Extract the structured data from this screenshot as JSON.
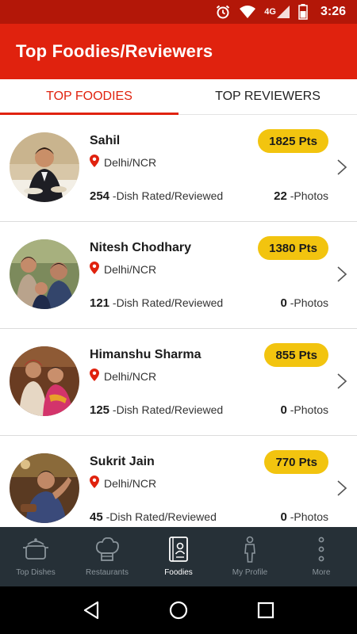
{
  "status_bar": {
    "time": "3:26",
    "network": "4G"
  },
  "app_bar": {
    "title": "Top Foodies/Reviewers"
  },
  "tabs": [
    {
      "label": "TOP FOODIES",
      "active": true
    },
    {
      "label": "TOP REVIEWERS",
      "active": false
    }
  ],
  "users": [
    {
      "name": "Sahil",
      "points": "1825 Pts",
      "location": "Delhi/NCR",
      "dishes": "254",
      "dishes_label": "-Dish Rated/Reviewed",
      "photos": "22",
      "photos_label": "-Photos"
    },
    {
      "name": "Nitesh Chodhary",
      "points": "1380 Pts",
      "location": "Delhi/NCR",
      "dishes": "121",
      "dishes_label": "-Dish Rated/Reviewed",
      "photos": "0",
      "photos_label": "-Photos"
    },
    {
      "name": "Himanshu Sharma",
      "points": "855 Pts",
      "location": "Delhi/NCR",
      "dishes": "125",
      "dishes_label": "-Dish Rated/Reviewed",
      "photos": "0",
      "photos_label": "-Photos"
    },
    {
      "name": "Sukrit Jain",
      "points": "770 Pts",
      "location": "Delhi/NCR",
      "dishes": "45",
      "dishes_label": "-Dish Rated/Reviewed",
      "photos": "0",
      "photos_label": "-Photos"
    }
  ],
  "bottom_nav": [
    {
      "label": "Top Dishes",
      "icon": "pot-icon",
      "active": false
    },
    {
      "label": "Restaurants",
      "icon": "chef-hat-icon",
      "active": false
    },
    {
      "label": "Foodies",
      "icon": "profile-book-icon",
      "active": true
    },
    {
      "label": "My Profile",
      "icon": "person-icon",
      "active": false
    },
    {
      "label": "More",
      "icon": "more-dots-icon",
      "active": false
    }
  ],
  "colors": {
    "brand": "#e0220e",
    "status_bar": "#b31708",
    "badge": "#f2c40f",
    "nav_bg": "#263037"
  }
}
